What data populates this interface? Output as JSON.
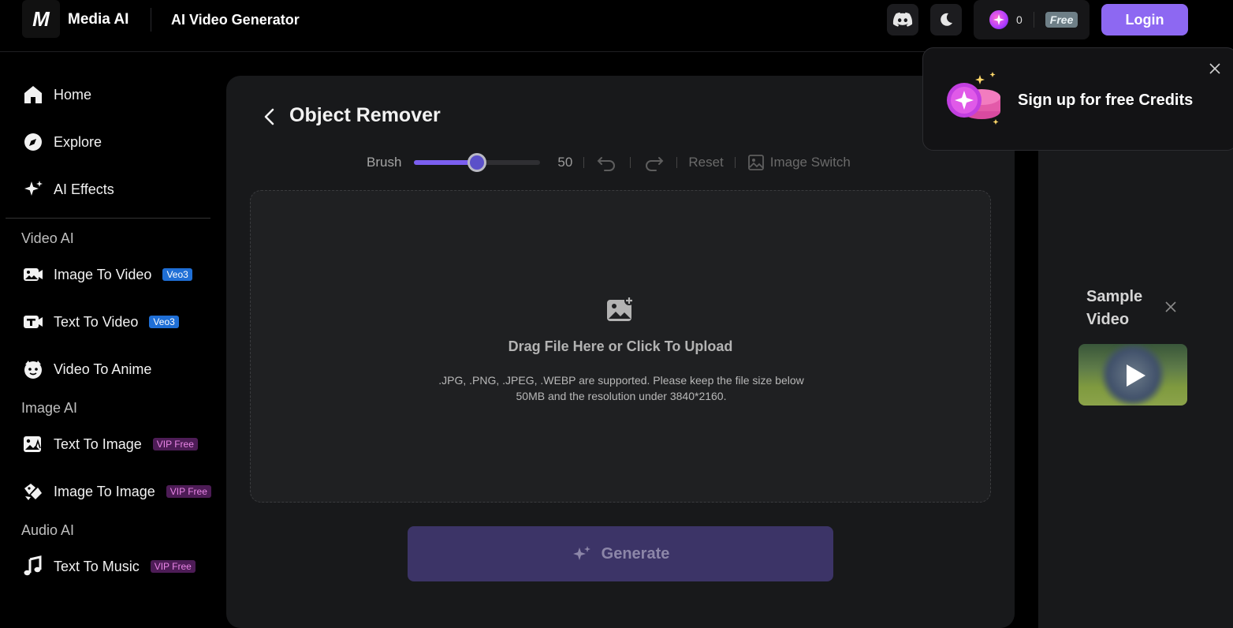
{
  "header": {
    "logo_text": "M",
    "brand": "Media AI",
    "section": "AI Video Generator",
    "credits": "0",
    "free_badge": "Free",
    "login_label": "Login"
  },
  "sidebar": {
    "top_items": [
      {
        "label": "Home",
        "icon": "home-icon"
      },
      {
        "label": "Explore",
        "icon": "compass-icon"
      },
      {
        "label": "AI Effects",
        "icon": "sparkle-icon"
      }
    ],
    "groups": [
      {
        "label": "Video AI",
        "items": [
          {
            "label": "Image To Video",
            "tag": "Veo3"
          },
          {
            "label": "Text To Video",
            "tag": "Veo3"
          },
          {
            "label": "Video To Anime",
            "tag": ""
          }
        ]
      },
      {
        "label": "Image AI",
        "items": [
          {
            "label": "Text To Image",
            "tag": "VIP Free"
          },
          {
            "label": "Image To Image",
            "tag": "VIP Free"
          }
        ]
      },
      {
        "label": "Audio AI",
        "items": [
          {
            "label": "Text To Music",
            "tag": "VIP Free"
          }
        ]
      }
    ]
  },
  "main": {
    "title": "Object Remover",
    "toolbar": {
      "brush_label": "Brush",
      "brush_value": "50",
      "brush_fraction": 0.5,
      "reset_label": "Reset",
      "image_switch_label": "Image Switch"
    },
    "upload": {
      "title": "Drag File Here or Click To Upload",
      "hint": ".JPG, .PNG, .JPEG, .WEBP are supported. Please keep the file size below 50MB and the resolution under 3840*2160."
    },
    "generate_label": "Generate"
  },
  "sample": {
    "title": "Sample Video"
  },
  "popup": {
    "text": "Sign up for free Credits"
  },
  "colors": {
    "accent": "#8d68f2",
    "generate_disabled": "#3c3467",
    "veo_tag": "#1f6fd6",
    "vip_tag": "#4d1c56"
  }
}
